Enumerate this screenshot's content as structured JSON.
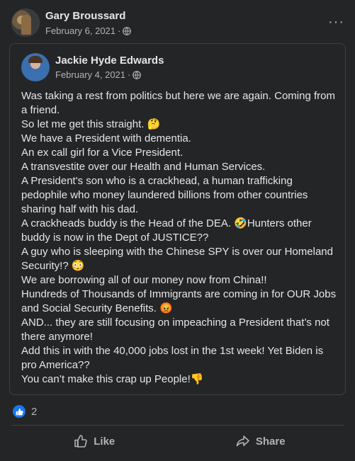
{
  "post": {
    "author": "Gary Broussard",
    "date": "February 6, 2021",
    "dot": "·",
    "more_icon": "···"
  },
  "shared_post": {
    "author": "Jackie Hyde Edwards",
    "date": "February 4, 2021",
    "dot": "·",
    "lines": [
      "Was taking a rest from politics but here we are again. Coming from a friend.",
      "So let me get this straight. 🤔",
      "We have a President with dementia.",
      "An ex call girl for a Vice President.",
      "A transvestite over our Health and Human Services.",
      "A President's son who is a crackhead, a human trafficking pedophile who money laundered billions from other countries sharing half with his dad.",
      "A crackheads buddy is the Head of the DEA. 🤣Hunters other buddy is now in the Dept of JUSTICE??",
      "A guy who is sleeping with the Chinese SPY is over our Homeland Security!? 😳",
      "We are borrowing all of our money now from China!!",
      "Hundreds of Thousands of Immigrants are coming in for OUR Jobs and Social Security Benefits. 😡",
      "AND... they are still focusing on impeaching a President that’s not there anymore!",
      "Add this in with the 40,000 jobs lost in the 1st week! Yet Biden is pro America??",
      "You can’t make this crap up People!👎"
    ]
  },
  "reactions": {
    "count": "2"
  },
  "actions": {
    "like": "Like",
    "share": "Share"
  },
  "colors": {
    "background": "#242526",
    "text": "#e4e6eb",
    "muted": "#b0b3b8",
    "accent": "#1877f2"
  }
}
